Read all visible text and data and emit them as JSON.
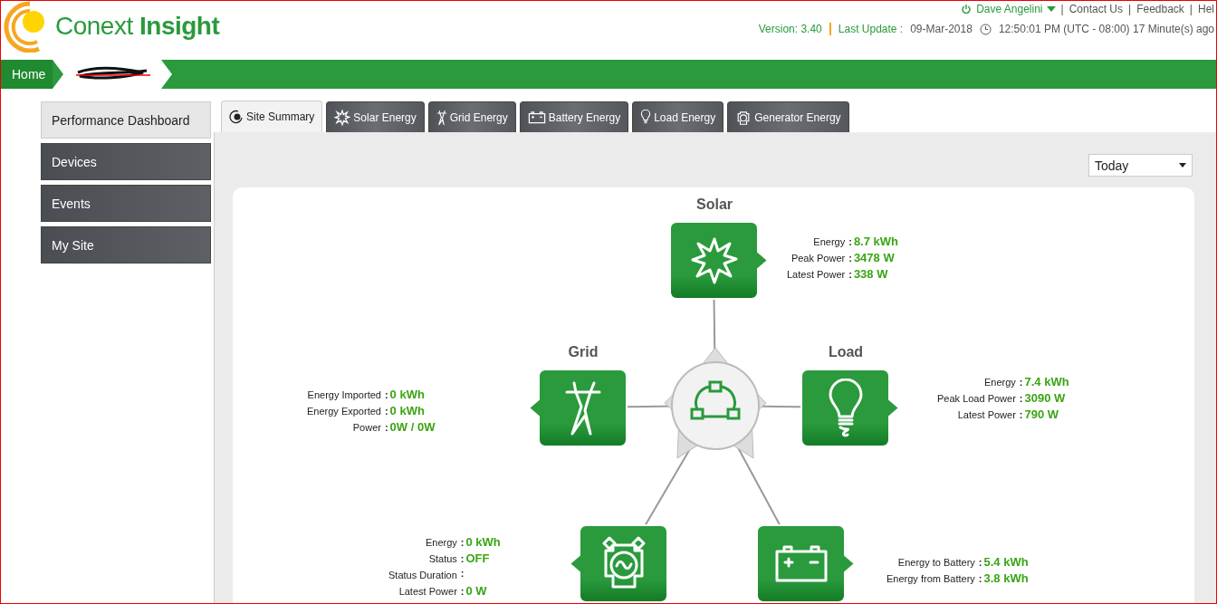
{
  "header": {
    "logo": {
      "light": "Conext",
      "bold": "Insight"
    },
    "user": "Dave Angelini",
    "links": [
      {
        "separator": "|",
        "label": "Contact Us"
      },
      {
        "separator": "|",
        "label": "Feedback"
      },
      {
        "separator": "|",
        "label": "Hel"
      }
    ],
    "version": "Version: 3.40",
    "last_update_label": "Last Update :",
    "last_update_date": "09-Mar-2018",
    "time": "12:50:01 PM (UTC - 08:00) 17 Minute(s) ago"
  },
  "breadcrumb": {
    "home": "Home"
  },
  "sidebar": {
    "items": [
      {
        "label": "Performance Dashboard",
        "selected": true
      },
      {
        "label": "Devices",
        "selected": false
      },
      {
        "label": "Events",
        "selected": false
      },
      {
        "label": "My Site",
        "selected": false
      }
    ]
  },
  "tabs": [
    {
      "kind": "summary",
      "label": "Site Summary",
      "selected": true
    },
    {
      "kind": "solar",
      "label": "Solar Energy",
      "selected": false
    },
    {
      "kind": "grid",
      "label": "Grid Energy",
      "selected": false
    },
    {
      "kind": "battery",
      "label": "Battery Energy",
      "selected": false
    },
    {
      "kind": "load",
      "label": "Load Energy",
      "selected": false
    },
    {
      "kind": "generator",
      "label": "Generator Energy",
      "selected": false
    }
  ],
  "period": "Today",
  "nodes": [
    {
      "kind": "solar",
      "title": "Solar",
      "metrics": [
        {
          "label": "Energy",
          "colon": ":",
          "value": "8.7 kWh"
        },
        {
          "label": "Peak Power",
          "colon": ":",
          "value": "3478 W"
        },
        {
          "label": "Latest Power",
          "colon": ":",
          "value": "338 W"
        }
      ]
    },
    {
      "kind": "grid",
      "title": "Grid",
      "metrics": [
        {
          "label": "Energy Imported",
          "colon": ":",
          "value": "0 kWh"
        },
        {
          "label": "Energy Exported",
          "colon": ":",
          "value": "0 kWh"
        },
        {
          "label": "Power",
          "colon": ":",
          "value": "0W / 0W"
        }
      ]
    },
    {
      "kind": "load",
      "title": "Load",
      "metrics": [
        {
          "label": "Energy",
          "colon": ":",
          "value": "7.4 kWh"
        },
        {
          "label": "Peak Load Power",
          "colon": ":",
          "value": "3090 W"
        },
        {
          "label": "Latest Power",
          "colon": ":",
          "value": "790 W"
        }
      ]
    },
    {
      "kind": "generator",
      "metrics": [
        {
          "label": "Energy",
          "colon": ":",
          "value": "0 kWh"
        },
        {
          "label": "Status",
          "colon": ":",
          "value": "OFF"
        },
        {
          "label": "Status Duration",
          "colon": ":"
        },
        {
          "label": "Latest Power",
          "colon": ":",
          "value": "0 W"
        }
      ]
    },
    {
      "kind": "battery",
      "metrics": [
        {
          "label": "Energy to Battery",
          "colon": ":",
          "value": "5.4 kWh"
        },
        {
          "label": "Energy from Battery",
          "colon": ":",
          "value": "3.8 kWh"
        }
      ]
    }
  ]
}
